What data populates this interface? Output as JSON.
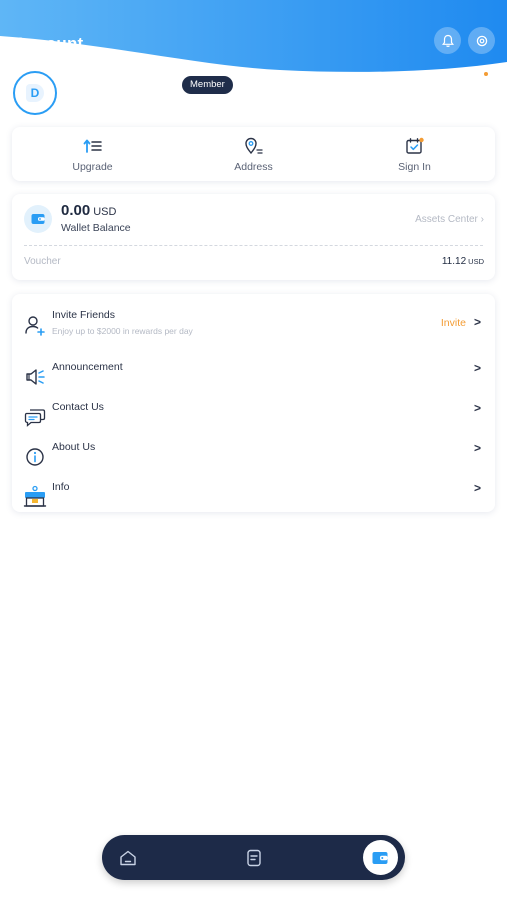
{
  "header": {
    "title": "Account"
  },
  "profile": {
    "avatar_initial": "D",
    "badge": "Member"
  },
  "quick_actions": [
    {
      "label": "Upgrade",
      "icon": "upgrade-icon"
    },
    {
      "label": "Address",
      "icon": "location-pin-icon"
    },
    {
      "label": "Sign In",
      "icon": "calendar-check-icon"
    }
  ],
  "wallet": {
    "amount": "0.00",
    "currency": "USD",
    "label": "Wallet Balance",
    "assets_link": "Assets Center",
    "voucher_label": "Voucher",
    "voucher_value": "11.12",
    "voucher_currency": "USD"
  },
  "menu": [
    {
      "label": "Invite Friends",
      "sub": "Enjoy up to $2000 in rewards per day",
      "action": "Invite",
      "icon": "user-add-icon"
    },
    {
      "label": "Announcement",
      "icon": "megaphone-icon"
    },
    {
      "label": "Contact Us",
      "icon": "chat-bubble-icon"
    },
    {
      "label": "About Us",
      "icon": "info-icon"
    },
    {
      "label": "Info",
      "icon": "info-booth-icon"
    }
  ],
  "tabbar": [
    {
      "name": "home",
      "icon": "home-icon"
    },
    {
      "name": "orders",
      "icon": "document-icon"
    },
    {
      "name": "wallet",
      "icon": "wallet-icon",
      "active": true
    }
  ],
  "colors": {
    "accent": "#2a9df4",
    "navy": "#1d2a48",
    "orange": "#f39c34"
  }
}
